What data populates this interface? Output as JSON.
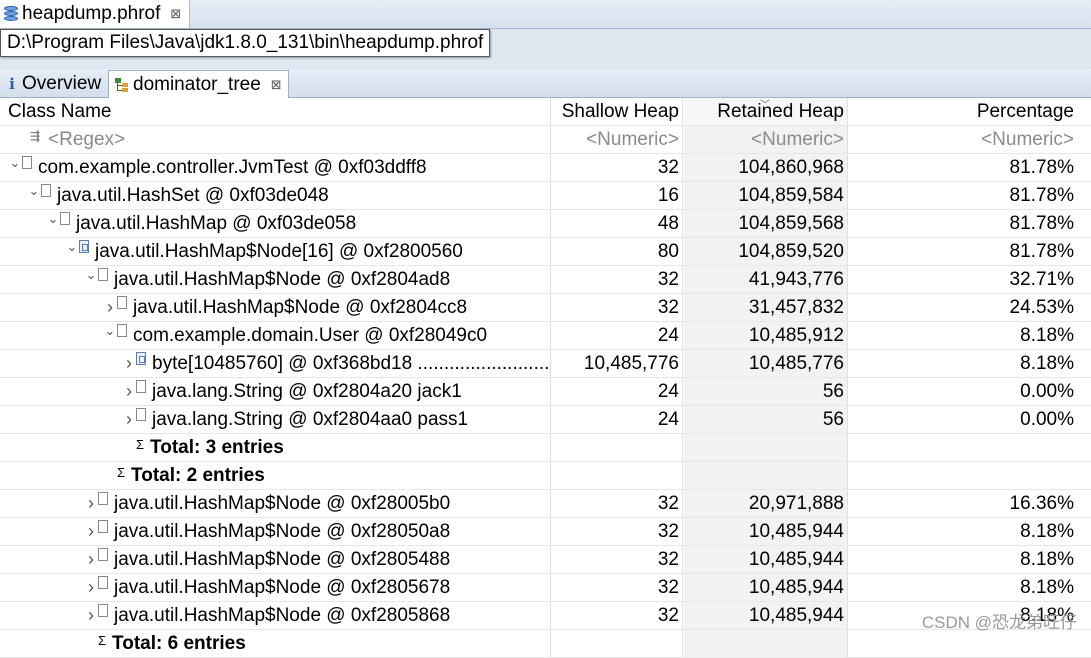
{
  "editor_tab": {
    "label": "heapdump.phrof",
    "icon": "database-icon",
    "close": "⊠"
  },
  "tooltip": "D:\\Program Files\\Java\\jdk1.8.0_131\\bin\\heapdump.phrof",
  "view_tabs": [
    {
      "label": "Overview",
      "icon": "info-icon"
    },
    {
      "label": "dominator_tree",
      "icon": "tree-icon",
      "close": "⊠",
      "active": true
    }
  ],
  "columns": {
    "class_name": "Class Name",
    "shallow_heap": "Shallow Heap",
    "retained_heap": "Retained Heap",
    "percentage": "Percentage"
  },
  "filters": {
    "class_name": "<Regex>",
    "shallow_heap": "<Numeric>",
    "retained_heap": "<Numeric>",
    "percentage": "<Numeric>"
  },
  "rows": [
    {
      "indent": 0,
      "twisty": "expanded",
      "icon": "object",
      "name": "com.example.controller.JvmTest @ 0xf03ddff8",
      "shallow": "32",
      "retained": "104,860,968",
      "pct": "81.78%"
    },
    {
      "indent": 1,
      "twisty": "expanded",
      "icon": "object",
      "name": "java.util.HashSet @ 0xf03de048",
      "shallow": "16",
      "retained": "104,859,584",
      "pct": "81.78%"
    },
    {
      "indent": 2,
      "twisty": "expanded",
      "icon": "object",
      "name": "java.util.HashMap @ 0xf03de058",
      "shallow": "48",
      "retained": "104,859,568",
      "pct": "81.78%"
    },
    {
      "indent": 3,
      "twisty": "expanded",
      "icon": "array",
      "name": "java.util.HashMap$Node[16] @ 0xf2800560",
      "shallow": "80",
      "retained": "104,859,520",
      "pct": "81.78%"
    },
    {
      "indent": 4,
      "twisty": "expanded",
      "icon": "object",
      "name": "java.util.HashMap$Node @ 0xf2804ad8",
      "shallow": "32",
      "retained": "41,943,776",
      "pct": "32.71%"
    },
    {
      "indent": 5,
      "twisty": "collapsed",
      "icon": "object",
      "name": "java.util.HashMap$Node @ 0xf2804cc8",
      "shallow": "32",
      "retained": "31,457,832",
      "pct": "24.53%"
    },
    {
      "indent": 5,
      "twisty": "expanded",
      "icon": "object",
      "name": "com.example.domain.User @ 0xf28049c0",
      "shallow": "24",
      "retained": "10,485,912",
      "pct": "8.18%"
    },
    {
      "indent": 6,
      "twisty": "collapsed",
      "icon": "array",
      "name": "byte[10485760] @ 0xf368bd18  ..........................",
      "shallow": "10,485,776",
      "retained": "10,485,776",
      "pct": "8.18%"
    },
    {
      "indent": 6,
      "twisty": "collapsed",
      "icon": "object",
      "name": "java.lang.String @ 0xf2804a20  jack1",
      "shallow": "24",
      "retained": "56",
      "pct": "0.00%"
    },
    {
      "indent": 6,
      "twisty": "collapsed",
      "icon": "object",
      "name": "java.lang.String @ 0xf2804aa0  pass1",
      "shallow": "24",
      "retained": "56",
      "pct": "0.00%"
    },
    {
      "indent": 6,
      "twisty": "none",
      "icon": "sigma",
      "name": "Total: 3 entries",
      "total": true,
      "shallow": "",
      "retained": "",
      "pct": ""
    },
    {
      "indent": 5,
      "twisty": "none",
      "icon": "sigma",
      "name": "Total: 2 entries",
      "total": true,
      "shallow": "",
      "retained": "",
      "pct": ""
    },
    {
      "indent": 4,
      "twisty": "collapsed",
      "icon": "object",
      "name": "java.util.HashMap$Node @ 0xf28005b0",
      "shallow": "32",
      "retained": "20,971,888",
      "pct": "16.36%"
    },
    {
      "indent": 4,
      "twisty": "collapsed",
      "icon": "object",
      "name": "java.util.HashMap$Node @ 0xf28050a8",
      "shallow": "32",
      "retained": "10,485,944",
      "pct": "8.18%"
    },
    {
      "indent": 4,
      "twisty": "collapsed",
      "icon": "object",
      "name": "java.util.HashMap$Node @ 0xf2805488",
      "shallow": "32",
      "retained": "10,485,944",
      "pct": "8.18%"
    },
    {
      "indent": 4,
      "twisty": "collapsed",
      "icon": "object",
      "name": "java.util.HashMap$Node @ 0xf2805678",
      "shallow": "32",
      "retained": "10,485,944",
      "pct": "8.18%"
    },
    {
      "indent": 4,
      "twisty": "collapsed",
      "icon": "object",
      "name": "java.util.HashMap$Node @ 0xf2805868",
      "shallow": "32",
      "retained": "10,485,944",
      "pct": "8.18%"
    },
    {
      "indent": 4,
      "twisty": "none",
      "icon": "sigma",
      "name": "Total: 6 entries",
      "total": true,
      "shallow": "",
      "retained": "",
      "pct": ""
    }
  ],
  "watermark": "CSDN @恐龙弟旺仔"
}
